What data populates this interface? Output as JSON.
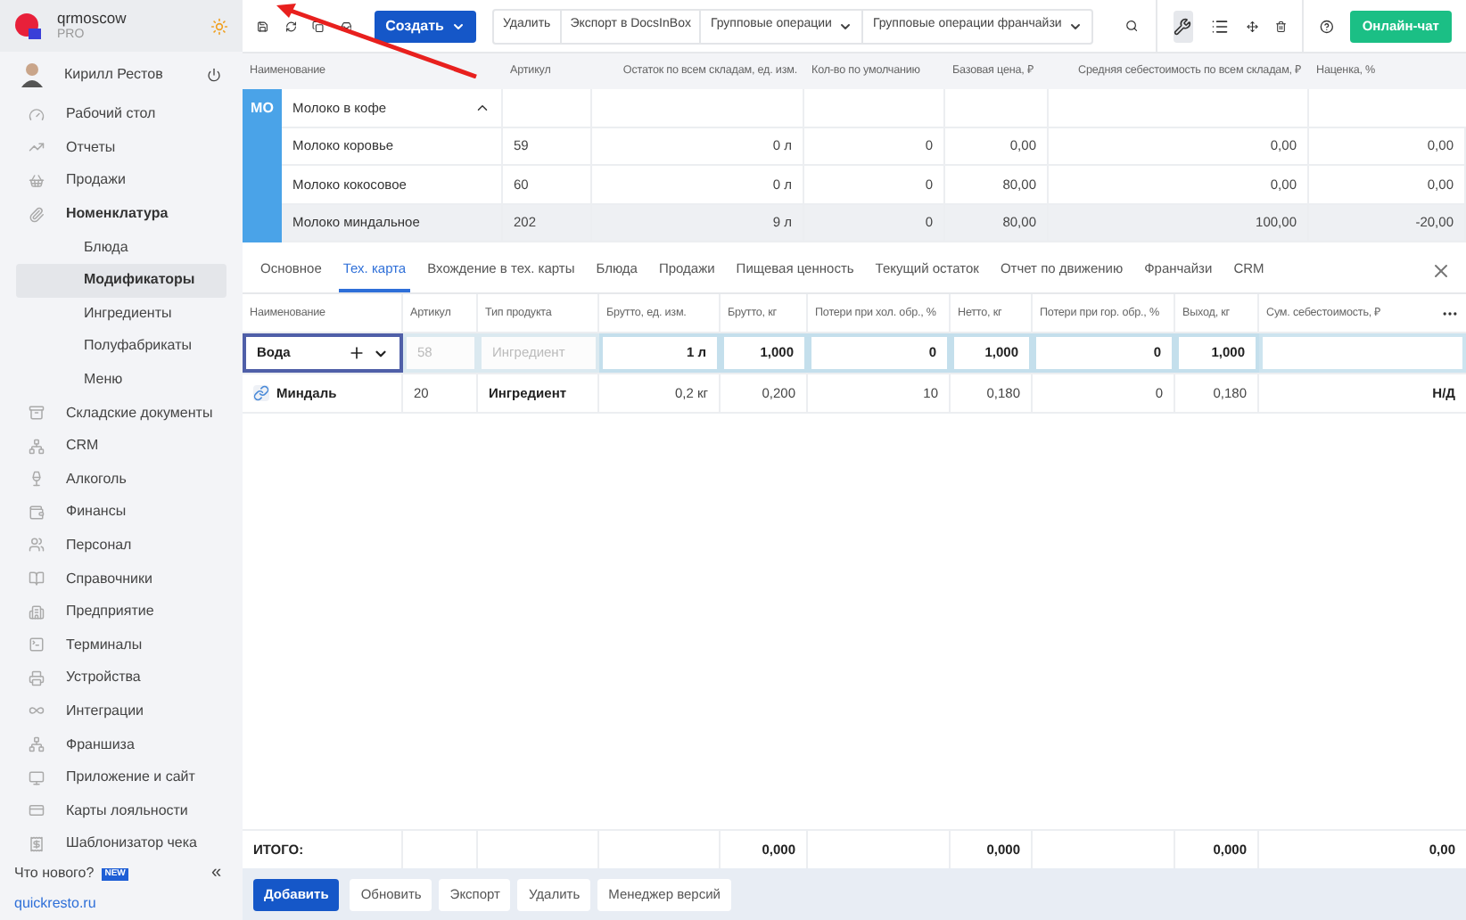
{
  "sidebar": {
    "account": {
      "name": "qrmoscow",
      "plan": "PRO"
    },
    "user": "Кирилл Рестов",
    "items": [
      {
        "label": "Рабочий стол",
        "selected": false
      },
      {
        "label": "Отчеты",
        "selected": false
      },
      {
        "label": "Продажи",
        "selected": false
      },
      {
        "label": "Номенклатура",
        "selected": false,
        "expanded": true,
        "children": [
          {
            "label": "Блюда",
            "selected": false
          },
          {
            "label": "Модификаторы",
            "selected": true
          },
          {
            "label": "Ингредиенты",
            "selected": false
          },
          {
            "label": "Полуфабрикаты",
            "selected": false
          },
          {
            "label": "Меню",
            "selected": false
          }
        ]
      },
      {
        "label": "Складские документы",
        "selected": false
      },
      {
        "label": "CRM",
        "selected": false
      },
      {
        "label": "Алкоголь",
        "selected": false
      },
      {
        "label": "Финансы",
        "selected": false
      },
      {
        "label": "Персонал",
        "selected": false
      },
      {
        "label": "Справочники",
        "selected": false
      },
      {
        "label": "Предприятие",
        "selected": false
      },
      {
        "label": "Терминалы",
        "selected": false
      },
      {
        "label": "Устройства",
        "selected": false
      },
      {
        "label": "Интеграции",
        "selected": false
      },
      {
        "label": "Франшиза",
        "selected": false
      },
      {
        "label": "Приложение и сайт",
        "selected": false
      },
      {
        "label": "Карты лояльности",
        "selected": false
      },
      {
        "label": "Шаблонизатор чека",
        "selected": false
      }
    ],
    "whats_new": {
      "label": "Что нового?",
      "badge": "NEW"
    },
    "collapse": "«",
    "footer_link": "quickresto.ru"
  },
  "toolbar": {
    "create": "Создать",
    "actions": [
      {
        "label": "Удалить",
        "dropdown": false
      },
      {
        "label": "Экспорт в DocsInBox",
        "dropdown": false
      },
      {
        "label": "Групповые операции",
        "dropdown": true
      },
      {
        "label": "Групповые операции франчайзи",
        "dropdown": true
      }
    ],
    "view_modes": [
      {
        "selected": true
      },
      {
        "selected": false
      }
    ],
    "chat": "Онлайн-чат"
  },
  "list_table": {
    "columns": [
      "Наименование",
      "Артикул",
      "Остаток по всем складам, ед. изм.",
      "Кол-во по умолчанию",
      "Базовая цена, ₽",
      "Средняя себестоимость по всем складам, ₽",
      "Наценка, %"
    ],
    "group": {
      "badge": "МО",
      "name": "Молоко в кофе",
      "expanded": true
    },
    "rows": [
      {
        "cells": [
          "Молоко коровье",
          "59",
          "0 л",
          "0",
          "0,00",
          "0,00",
          "0,00"
        ],
        "selected": false
      },
      {
        "cells": [
          "Молоко кокосовое",
          "60",
          "0 л",
          "0",
          "80,00",
          "0,00",
          "0,00"
        ],
        "selected": false
      },
      {
        "cells": [
          "Молоко миндальное",
          "202",
          "9 л",
          "0",
          "80,00",
          "100,00",
          "-20,00"
        ],
        "selected": true
      }
    ]
  },
  "tabs": [
    {
      "label": "Основное",
      "selected": false
    },
    {
      "label": "Тех. карта",
      "selected": true
    },
    {
      "label": "Вхождение в тех. карты",
      "selected": false
    },
    {
      "label": "Блюда",
      "selected": false
    },
    {
      "label": "Продажи",
      "selected": false
    },
    {
      "label": "Пищевая ценность",
      "selected": false
    },
    {
      "label": "Текущий остаток",
      "selected": false
    },
    {
      "label": "Отчет по движению",
      "selected": false
    },
    {
      "label": "Франчайзи",
      "selected": false
    },
    {
      "label": "CRM",
      "selected": false
    }
  ],
  "tech_card": {
    "columns": [
      "Наименование",
      "Артикул",
      "Тип продукта",
      "Брутто, ед. изм.",
      "Брутто, кг",
      "Потери при хол. обр., %",
      "Нетто, кг",
      "Потери при гор. обр., %",
      "Выход, кг",
      "Сум. себестоимость, ₽"
    ],
    "rows": [
      {
        "kind": "edit",
        "cells": [
          {
            "text": "Вода",
            "disabled": false
          },
          {
            "text": "58",
            "disabled": true
          },
          {
            "text": "Ингредиент",
            "disabled": true
          },
          {
            "text": "1 л",
            "disabled": false
          },
          {
            "text": "1,000",
            "disabled": false
          },
          {
            "text": "0",
            "disabled": false
          },
          {
            "text": "1,000",
            "disabled": false
          },
          {
            "text": "0",
            "disabled": false
          },
          {
            "text": "1,000",
            "disabled": false
          }
        ]
      },
      {
        "kind": "item",
        "cells": [
          {
            "text": "Миндаль"
          },
          {
            "text": "20"
          },
          {
            "text": "Ингредиент"
          },
          {
            "text": "0,2 кг"
          },
          {
            "text": "0,200"
          },
          {
            "text": "10"
          },
          {
            "text": "0,180"
          },
          {
            "text": "0"
          },
          {
            "text": "0,180"
          },
          {
            "text": "Н/Д"
          }
        ]
      }
    ],
    "total": {
      "label": "ИТОГО:",
      "brutto_kg": "0,000",
      "netto_kg": "0,000",
      "output_kg": "0,000",
      "cost": "0,00"
    }
  },
  "bottom_buttons": [
    {
      "label": "Добавить",
      "primary": true
    },
    {
      "label": "Обновить",
      "primary": false
    },
    {
      "label": "Экспорт",
      "primary": false
    },
    {
      "label": "Удалить",
      "primary": false
    },
    {
      "label": "Менеджер версий",
      "primary": false
    }
  ]
}
